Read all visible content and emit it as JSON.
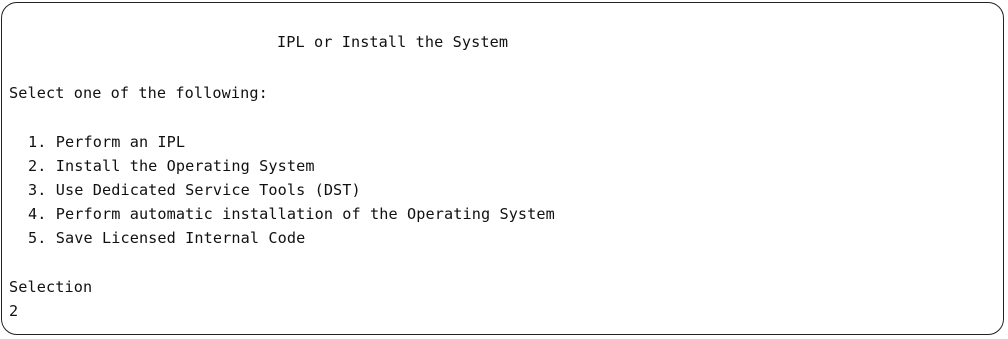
{
  "screen": {
    "title": "IPL or Install the System",
    "prompt": "Select one of the following:",
    "options": [
      {
        "number": "1.",
        "label": "Perform an IPL"
      },
      {
        "number": "2.",
        "label": "Install the Operating System"
      },
      {
        "number": "3.",
        "label": "Use Dedicated Service Tools (DST)"
      },
      {
        "number": "4.",
        "label": "Perform automatic installation of the Operating System"
      },
      {
        "number": "5.",
        "label": "Save Licensed Internal Code"
      }
    ],
    "selection_label": "Selection",
    "selection_value": "2"
  }
}
